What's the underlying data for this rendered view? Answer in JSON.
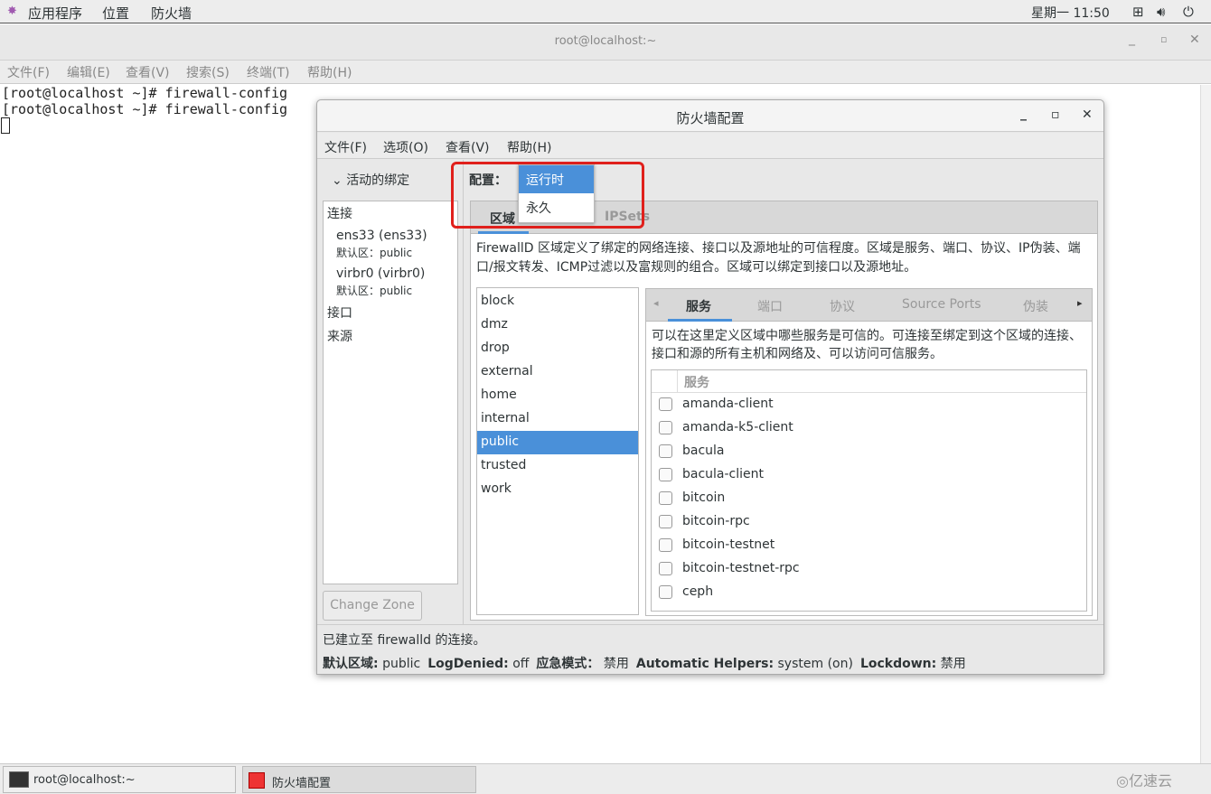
{
  "topbar": {
    "apps": "应用程序",
    "places": "位置",
    "firewall": "防火墙",
    "clock": "星期一 11:50",
    "icons": [
      "network-icon",
      "volume-icon",
      "power-icon"
    ]
  },
  "terminal": {
    "title": "root@localhost:~",
    "menu": [
      "文件(F)",
      "编辑(E)",
      "查看(V)",
      "搜索(S)",
      "终端(T)",
      "帮助(H)"
    ],
    "lines": [
      "[root@localhost ~]# firewall-config",
      "[root@localhost ~]# firewall-config"
    ]
  },
  "dialog": {
    "title": "防火墙配置",
    "menu": [
      "文件(F)",
      "选项(O)",
      "查看(V)",
      "帮助(H)"
    ],
    "bindings": {
      "header": "活动的绑定",
      "connections_label": "连接",
      "connections": [
        {
          "name": "ens33 (ens33)",
          "zone": "默认区：public"
        },
        {
          "name": "virbr0 (virbr0)",
          "zone": "默认区：public"
        }
      ],
      "interfaces_label": "接口",
      "sources_label": "来源",
      "change_zone": "Change Zone"
    },
    "config": {
      "label": "配置：",
      "options": [
        "运行时",
        "永久"
      ],
      "selected": "运行时"
    },
    "tabs": [
      "区域",
      "IPSets"
    ],
    "zone_desc": "FirewallD 区域定义了绑定的网络连接、接口以及源地址的可信程度。区域是服务、端口、协议、IP伪装、端口/报文转发、ICMP过滤以及富规则的组合。区域可以绑定到接口以及源地址。",
    "zones": [
      "block",
      "dmz",
      "drop",
      "external",
      "home",
      "internal",
      "public",
      "trusted",
      "work"
    ],
    "selected_zone": "public",
    "subtabs": [
      "服务",
      "端口",
      "协议",
      "Source Ports",
      "伪装"
    ],
    "services_desc": "可以在这里定义区域中哪些服务是可信的。可连接至绑定到这个区域的连接、接口和源的所有主机和网络及、可以访问可信服务。",
    "services_header": "服务",
    "services": [
      "amanda-client",
      "amanda-k5-client",
      "bacula",
      "bacula-client",
      "bitcoin",
      "bitcoin-rpc",
      "bitcoin-testnet",
      "bitcoin-testnet-rpc",
      "ceph"
    ],
    "status": "已建立至  firewalld 的连接。",
    "info": [
      {
        "k": "默认区域:",
        "v": "public"
      },
      {
        "k": "LogDenied:",
        "v": "off"
      },
      {
        "k": "应急模式：",
        "v": "禁用"
      },
      {
        "k": "Automatic Helpers:",
        "v": "system (on)"
      },
      {
        "k": "Lockdown:",
        "v": "禁用"
      }
    ]
  },
  "taskbar": [
    "root@localhost:~",
    "防火墙配置"
  ],
  "colors": {
    "accent": "#4a90d9",
    "highlight": "#e0201c"
  }
}
